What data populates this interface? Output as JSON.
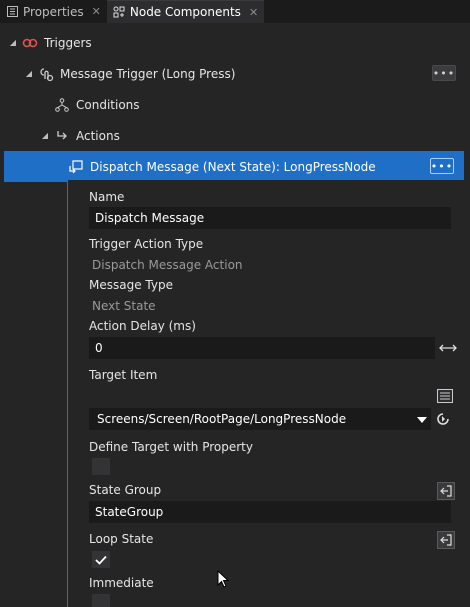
{
  "tabs": [
    {
      "label": "Properties",
      "icon": "properties-icon",
      "active": false
    },
    {
      "label": "Node Components",
      "icon": "node-components-icon",
      "active": true
    }
  ],
  "tree": {
    "triggers": {
      "label": "Triggers",
      "icon": "triggers-icon"
    },
    "message_trigger": {
      "label": "Message Trigger (Long Press)",
      "icon": "message-trigger-icon",
      "more": "•••"
    },
    "conditions": {
      "label": "Conditions",
      "icon": "conditions-icon"
    },
    "actions": {
      "label": "Actions",
      "icon": "actions-icon"
    },
    "dispatch": {
      "label": "Dispatch Message (Next State): LongPressNode",
      "icon": "dispatch-message-icon",
      "more": "•••"
    }
  },
  "properties": {
    "name": {
      "label": "Name",
      "value": "Dispatch Message"
    },
    "trigger_action_type": {
      "label": "Trigger Action Type",
      "value": "Dispatch Message Action"
    },
    "message_type": {
      "label": "Message Type",
      "value": "Next State"
    },
    "action_delay": {
      "label": "Action Delay (ms)",
      "value": "0"
    },
    "target_item": {
      "label": "Target Item",
      "value": "Screens/Screen/RootPage/LongPressNode"
    },
    "define_target": {
      "label": "Define Target with Property",
      "checked": false
    },
    "state_group": {
      "label": "State Group",
      "value": "StateGroup"
    },
    "loop_state": {
      "label": "Loop State",
      "checked": true
    },
    "immediate": {
      "label": "Immediate",
      "checked": false
    }
  },
  "colors": {
    "selection": "#1e6fc5",
    "background": "#252526",
    "input_bg": "#1a1a1a",
    "trigger_red": "#e05252"
  }
}
